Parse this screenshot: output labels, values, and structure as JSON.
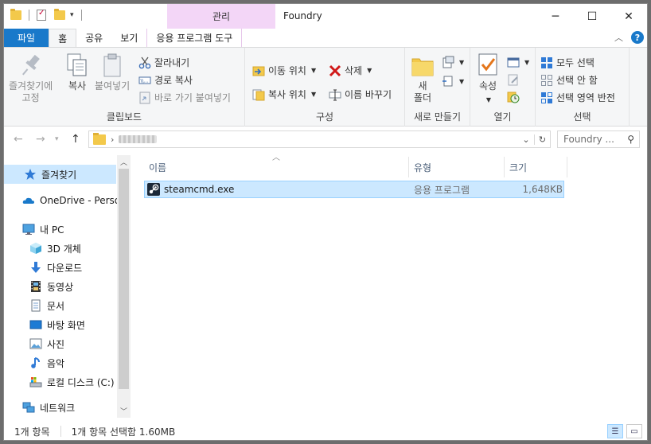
{
  "window": {
    "title": "Foundry",
    "tool_tab_header": "관리",
    "minimize": "─",
    "maximize": "☐",
    "close": "✕"
  },
  "ribbon_tabs": {
    "file": "파일",
    "home": "홈",
    "share": "공유",
    "view": "보기",
    "app_tools": "응용 프로그램 도구"
  },
  "ribbon": {
    "clipboard": {
      "label": "클립보드",
      "pin_line1": "즐겨찾기에",
      "pin_line2": "고정",
      "copy": "복사",
      "paste": "붙여넣기",
      "cut": "잘라내기",
      "copy_path": "경로 복사",
      "paste_shortcut": "바로 가기 붙여넣기"
    },
    "organize": {
      "label": "구성",
      "move_to": "이동 위치",
      "copy_to": "복사 위치",
      "delete": "삭제",
      "rename": "이름 바꾸기"
    },
    "new": {
      "label": "새로 만들기",
      "new_folder_line1": "새",
      "new_folder_line2": "폴더"
    },
    "open": {
      "label": "열기",
      "properties": "속성"
    },
    "select": {
      "label": "선택",
      "select_all": "모두 선택",
      "select_none": "선택 안 함",
      "invert": "선택 영역 반전"
    }
  },
  "address": {
    "search_placeholder": "Foundry ...",
    "separator": "›"
  },
  "nav_pane": {
    "items": [
      {
        "label": "즐겨찾기"
      },
      {
        "label": "OneDrive - Persor"
      },
      {
        "label": "내 PC"
      },
      {
        "label": "3D 개체"
      },
      {
        "label": "다운로드"
      },
      {
        "label": "동영상"
      },
      {
        "label": "문서"
      },
      {
        "label": "바탕 화면"
      },
      {
        "label": "사진"
      },
      {
        "label": "음악"
      },
      {
        "label": "로컬 디스크 (C:)"
      },
      {
        "label": "네트워크"
      }
    ]
  },
  "file_list": {
    "columns": {
      "name": "이름",
      "type": "유형",
      "size": "크기"
    },
    "rows": [
      {
        "name": "steamcmd.exe",
        "type": "응용 프로그램",
        "size": "1,648KB"
      }
    ]
  },
  "status": {
    "count": "1개 항목",
    "selection": "1개 항목 선택함 1.60MB"
  },
  "colors": {
    "accent": "#1979ca",
    "selection": "#cce8ff",
    "tool_tab": "#f3d6f7"
  }
}
